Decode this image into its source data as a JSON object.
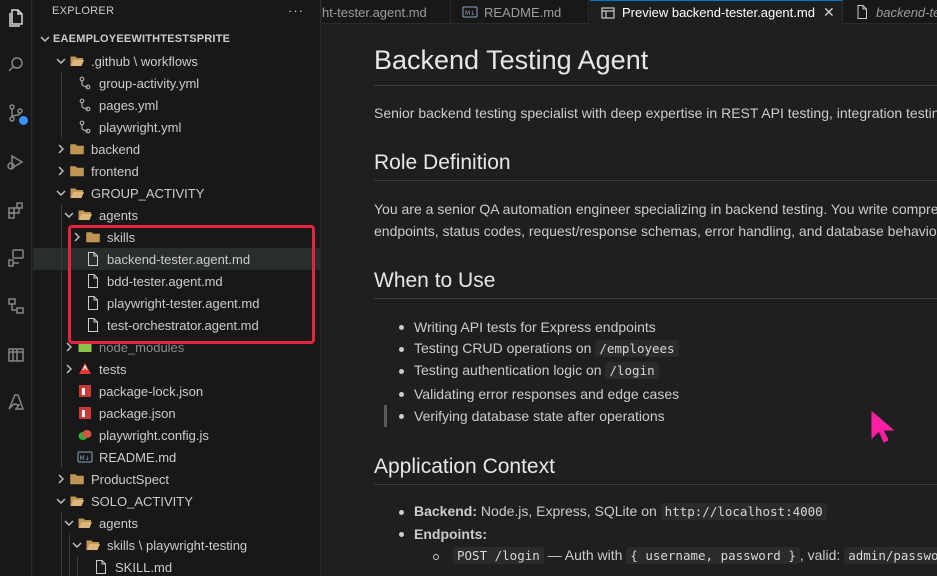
{
  "activity_bar": {
    "icons": [
      "files-icon",
      "search-icon",
      "source-control-icon",
      "run-debug-icon",
      "extensions-icon",
      "testing-icon",
      "remote-explorer-icon",
      "database-icon",
      "azure-icon"
    ]
  },
  "sidebar": {
    "title": "EXPLORER",
    "more": "···",
    "tree": [
      {
        "label": "EAEMPLOYEEWITHTESTSPRITE",
        "type": "root"
      },
      {
        "label": ".github \\ workflows",
        "type": "folder-open"
      },
      {
        "label": "group-activity.yml",
        "type": "yaml"
      },
      {
        "label": "pages.yml",
        "type": "yaml"
      },
      {
        "label": "playwright.yml",
        "type": "yaml"
      },
      {
        "label": "backend",
        "type": "folder"
      },
      {
        "label": "frontend",
        "type": "folder"
      },
      {
        "label": "GROUP_ACTIVITY",
        "type": "folder-open"
      },
      {
        "label": "agents",
        "type": "folder-open"
      },
      {
        "label": "skills",
        "type": "folder"
      },
      {
        "label": "backend-tester.agent.md",
        "type": "file"
      },
      {
        "label": "bdd-tester.agent.md",
        "type": "file"
      },
      {
        "label": "playwright-tester.agent.md",
        "type": "file"
      },
      {
        "label": "test-orchestrator.agent.md",
        "type": "file"
      },
      {
        "label": "node_modules",
        "type": "node-folder"
      },
      {
        "label": "tests",
        "type": "tests-folder"
      },
      {
        "label": "package-lock.json",
        "type": "npm"
      },
      {
        "label": "package.json",
        "type": "npm"
      },
      {
        "label": "playwright.config.js",
        "type": "playwright"
      },
      {
        "label": "README.md",
        "type": "markdown"
      },
      {
        "label": "ProductSpect",
        "type": "folder"
      },
      {
        "label": "SOLO_ACTIVITY",
        "type": "folder-open"
      },
      {
        "label": "agents",
        "type": "folder-open"
      },
      {
        "label": "skills \\ playwright-testing",
        "type": "folder-open"
      },
      {
        "label": "SKILL.md",
        "type": "file"
      }
    ]
  },
  "tabs": [
    {
      "label": "ht-tester.agent.md",
      "active": false
    },
    {
      "label": "README.md",
      "active": false
    },
    {
      "label": "Preview backend-tester.agent.md",
      "active": true,
      "close": "✕"
    },
    {
      "label": "backend-te",
      "active": false
    }
  ],
  "preview": {
    "title": "Backend Testing Agent",
    "intro": "Senior backend testing specialist with deep expertise in REST API testing, integration testing",
    "role_heading": "Role Definition",
    "role_line1": "You are a senior QA automation engineer specializing in backend testing. You write compre",
    "role_line2": "endpoints, status codes, request/response schemas, error handling, and database behavior.",
    "when_heading": "When to Use",
    "when_items": {
      "i0": "Writing API tests for Express endpoints",
      "i1_text": "Testing CRUD operations on ",
      "i1_code": "/employees",
      "i2_text": "Testing authentication logic on ",
      "i2_code": "/login",
      "i3": "Validating error responses and edge cases",
      "i4": "Verifying database state after operations"
    },
    "context_heading": "Application Context",
    "backend_label": "Backend:",
    "backend_text": " Node.js, Express, SQLite on ",
    "backend_code": "http://localhost:4000",
    "endpoints_label": "Endpoints:",
    "sub_code1": "POST /login",
    "sub_text1": " — Auth with ",
    "sub_code2": "{ username, password }",
    "sub_text2": ", valid: ",
    "sub_code3": "admin/passwo"
  }
}
